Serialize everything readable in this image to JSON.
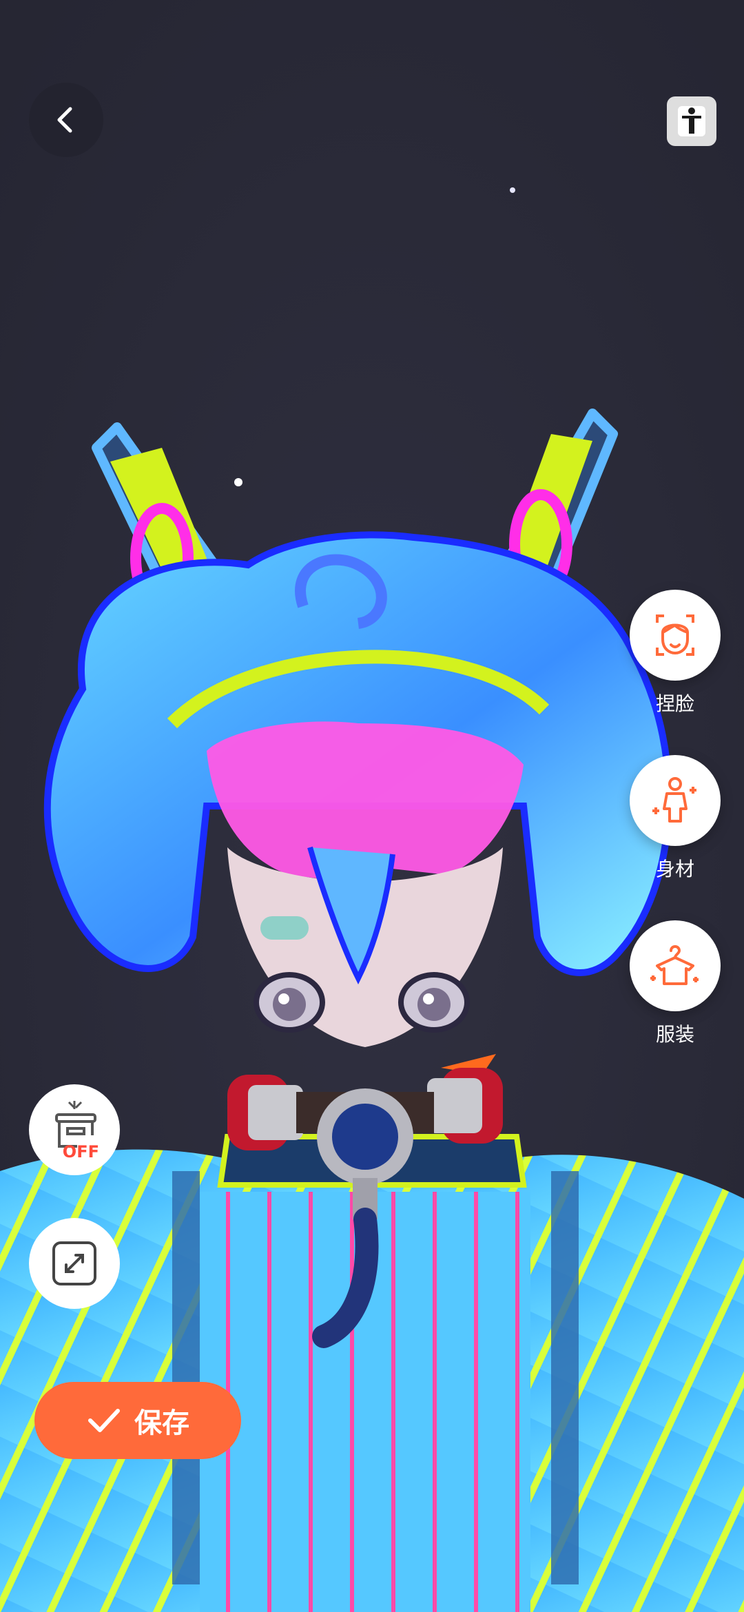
{
  "colors": {
    "accent": "#ff6a3a",
    "background": "#2a2a38"
  },
  "icons": {
    "back": "chevron-left-icon",
    "body_mode": "person-icon",
    "face": "face-icon",
    "body": "body-shape-icon",
    "outfit": "hanger-icon",
    "scene": "box-off-icon",
    "expand": "expand-icon",
    "save": "check-icon"
  },
  "side_menu": {
    "face_label": "捏脸",
    "body_label": "身材",
    "outfit_label": "服装"
  },
  "toggle": {
    "off_text": "OFF"
  },
  "save": {
    "label": "保存"
  }
}
